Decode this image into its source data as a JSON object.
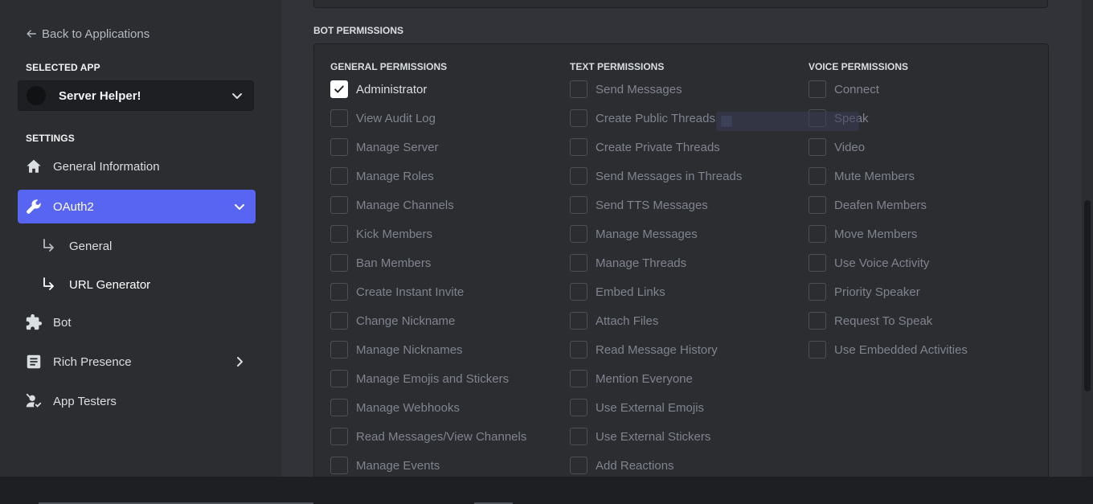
{
  "sidebar": {
    "back_label": "Back to Applications",
    "selected_app_heading": "SELECTED APP",
    "selected_app_name": "Server Helper!",
    "settings_heading": "SETTINGS",
    "items": [
      {
        "label": "General Information",
        "icon": "home-icon"
      },
      {
        "label": "OAuth2",
        "icon": "wrench-icon",
        "active": true
      },
      {
        "label": "General",
        "icon": "sub-arrow-icon"
      },
      {
        "label": "URL Generator",
        "icon": "sub-arrow-icon",
        "selected": true
      },
      {
        "label": "Bot",
        "icon": "puzzle-icon"
      },
      {
        "label": "Rich Presence",
        "icon": "document-icon"
      },
      {
        "label": "App Testers",
        "icon": "user-tester-icon"
      }
    ]
  },
  "main": {
    "bot_permissions_title": "BOT PERMISSIONS",
    "columns": [
      {
        "header": "GENERAL PERMISSIONS",
        "items": [
          {
            "label": "Administrator",
            "checked": true
          },
          {
            "label": "View Audit Log",
            "checked": false
          },
          {
            "label": "Manage Server",
            "checked": false
          },
          {
            "label": "Manage Roles",
            "checked": false
          },
          {
            "label": "Manage Channels",
            "checked": false
          },
          {
            "label": "Kick Members",
            "checked": false
          },
          {
            "label": "Ban Members",
            "checked": false
          },
          {
            "label": "Create Instant Invite",
            "checked": false
          },
          {
            "label": "Change Nickname",
            "checked": false
          },
          {
            "label": "Manage Nicknames",
            "checked": false
          },
          {
            "label": "Manage Emojis and Stickers",
            "checked": false
          },
          {
            "label": "Manage Webhooks",
            "checked": false
          },
          {
            "label": "Read Messages/View Channels",
            "checked": false
          },
          {
            "label": "Manage Events",
            "checked": false
          }
        ]
      },
      {
        "header": "TEXT PERMISSIONS",
        "items": [
          {
            "label": "Send Messages",
            "checked": false
          },
          {
            "label": "Create Public Threads",
            "checked": false
          },
          {
            "label": "Create Private Threads",
            "checked": false
          },
          {
            "label": "Send Messages in Threads",
            "checked": false
          },
          {
            "label": "Send TTS Messages",
            "checked": false
          },
          {
            "label": "Manage Messages",
            "checked": false
          },
          {
            "label": "Manage Threads",
            "checked": false
          },
          {
            "label": "Embed Links",
            "checked": false
          },
          {
            "label": "Attach Files",
            "checked": false
          },
          {
            "label": "Read Message History",
            "checked": false
          },
          {
            "label": "Mention Everyone",
            "checked": false
          },
          {
            "label": "Use External Emojis",
            "checked": false
          },
          {
            "label": "Use External Stickers",
            "checked": false
          },
          {
            "label": "Add Reactions",
            "checked": false
          }
        ]
      },
      {
        "header": "VOICE PERMISSIONS",
        "items": [
          {
            "label": "Connect",
            "checked": false
          },
          {
            "label": "Speak",
            "checked": false
          },
          {
            "label": "Video",
            "checked": false
          },
          {
            "label": "Mute Members",
            "checked": false
          },
          {
            "label": "Deafen Members",
            "checked": false
          },
          {
            "label": "Move Members",
            "checked": false
          },
          {
            "label": "Use Voice Activity",
            "checked": false
          },
          {
            "label": "Priority Speaker",
            "checked": false
          },
          {
            "label": "Request To Speak",
            "checked": false
          },
          {
            "label": "Use Embedded Activities",
            "checked": false
          }
        ]
      }
    ]
  },
  "colors": {
    "accent": "#5865f2",
    "sidebar_bg": "#2b2d31",
    "main_bg": "#313338"
  }
}
